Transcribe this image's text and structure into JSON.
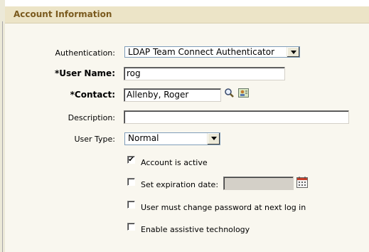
{
  "section": {
    "title": "Account Information"
  },
  "fields": {
    "authentication": {
      "label": "Authentication:",
      "value": "LDAP Team Connect Authenticator"
    },
    "user_name": {
      "label": "*User Name:",
      "value": "rog"
    },
    "contact": {
      "label": "*Contact:",
      "value": "Allenby, Roger"
    },
    "description": {
      "label": "Description:",
      "value": ""
    },
    "user_type": {
      "label": "User Type:",
      "value": "Normal"
    }
  },
  "checkboxes": {
    "account_active": {
      "label": "Account is active",
      "checked": true
    },
    "expiration": {
      "label": "Set expiration date:",
      "checked": false,
      "date_value": ""
    },
    "change_password": {
      "label": "User must change password at next log in",
      "checked": false
    },
    "assistive": {
      "label": "Enable assistive technology",
      "checked": false
    }
  },
  "colors": {
    "header_bg": "#ece4c7",
    "header_text": "#7a5a1e",
    "panel_bg": "#f9f7ef"
  },
  "icons": {
    "contact_search": "magnifier-icon",
    "contact_card": "contact-card-icon",
    "calendar": "calendar-icon"
  }
}
